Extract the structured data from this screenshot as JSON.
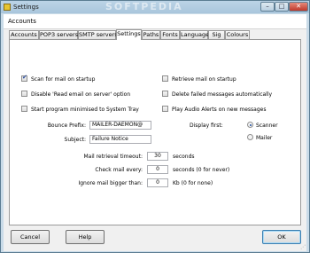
{
  "window": {
    "title": "Settings",
    "watermark": "SOFTPEDIA",
    "min_glyph": "–",
    "max_glyph": "□",
    "close_glyph": "✕"
  },
  "header": {
    "title": "Accounts"
  },
  "tabs": [
    {
      "label": "Accounts"
    },
    {
      "label": "POP3 servers"
    },
    {
      "label": "SMTP servers"
    },
    {
      "label": "Settings",
      "active": true
    },
    {
      "label": "Paths"
    },
    {
      "label": "Fonts"
    },
    {
      "label": "Language"
    },
    {
      "label": "Sig"
    },
    {
      "label": "Colours"
    }
  ],
  "settings": {
    "scan_on_startup": {
      "label": "Scan for mail on startup",
      "checked": true
    },
    "disable_read_email": {
      "label": "Disable 'Read email on server' option",
      "checked": false
    },
    "start_minimised": {
      "label": "Start program minimised to System Tray",
      "checked": false
    },
    "retrieve_on_startup": {
      "label": "Retrieve mail on startup",
      "checked": false
    },
    "delete_failed": {
      "label": "Delete failed messages automatically",
      "checked": false
    },
    "play_audio": {
      "label": "Play Audio Alerts on new messages",
      "checked": false
    },
    "bounce_prefix": {
      "label": "Bounce Prefix:",
      "value": "MAILER-DAEMON@"
    },
    "subject": {
      "label": "Subject:",
      "value": "Failure Notice"
    },
    "display_first": {
      "label": "Display first:",
      "options": [
        "Scanner",
        "Mailer"
      ],
      "selected": "Scanner"
    },
    "retrieval_timeout": {
      "label": "Mail retrieval timeout:",
      "value": "30",
      "unit": "seconds"
    },
    "check_every": {
      "label": "Check mail every:",
      "value": "0",
      "unit": "seconds (0 for never)"
    },
    "ignore_bigger": {
      "label": "Ignore mail bigger than:",
      "value": "0",
      "unit": "Kb (0 for none)"
    }
  },
  "buttons": {
    "cancel": "Cancel",
    "help": "Help",
    "ok": "OK"
  }
}
